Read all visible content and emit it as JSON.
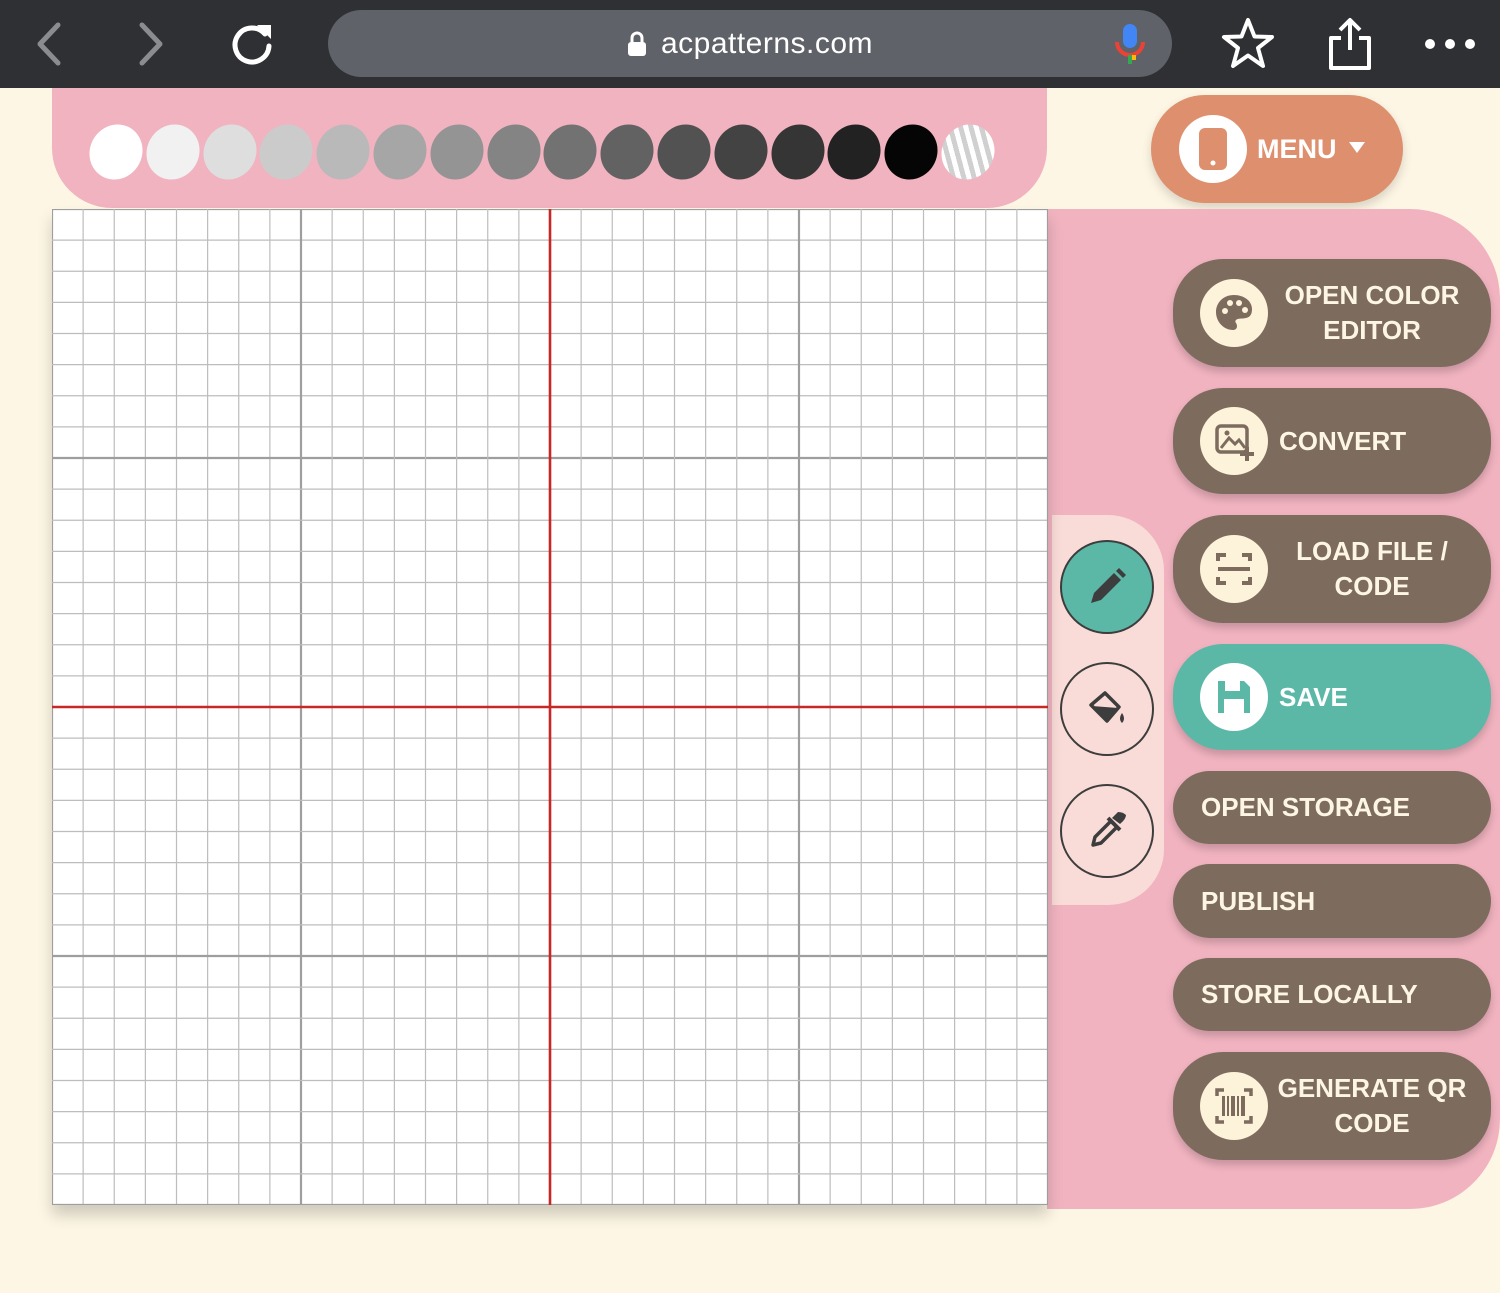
{
  "browser": {
    "url": "acpatterns.com",
    "back_icon": "chevron-left-icon",
    "forward_icon": "chevron-right-icon",
    "reload_icon": "reload-icon",
    "bookmark_icon": "star-icon",
    "share_icon": "share-icon",
    "more_icon": "more-dots-icon"
  },
  "palette": {
    "colors": [
      "#ffffff",
      "#f1f1f1",
      "#dedede",
      "#cbcbcb",
      "#b9b9b9",
      "#a6a6a6",
      "#949494",
      "#848484",
      "#727272",
      "#626262",
      "#525252",
      "#434343",
      "#353535",
      "#222222",
      "#050505"
    ],
    "transparent_swatch": "striped"
  },
  "menu": {
    "label": "MENU"
  },
  "tools": {
    "pencil": "pencil-icon",
    "fill": "paint-bucket-icon",
    "picker": "eyedropper-icon",
    "active": "pencil"
  },
  "actions": {
    "open_color_editor": "OPEN COLOR EDITOR",
    "convert": "CONVERT",
    "load_file_code": "LOAD FILE / CODE",
    "save": "SAVE",
    "open_storage": "OPEN STORAGE",
    "publish": "PUBLISH",
    "store_locally": "STORE LOCALLY",
    "generate_qr_code": "GENERATE QR CODE"
  },
  "grid": {
    "cells": 32,
    "major_every": 8,
    "axis_color": "#c62828",
    "line_color": "#bdbdbd",
    "major_color": "#9e9e9e"
  },
  "colors": {
    "pink": "#f1b3c0",
    "brown": "#7d6c5e",
    "teal": "#5bb8a7",
    "orange": "#de8f6d",
    "cream": "#fdf6e4"
  }
}
